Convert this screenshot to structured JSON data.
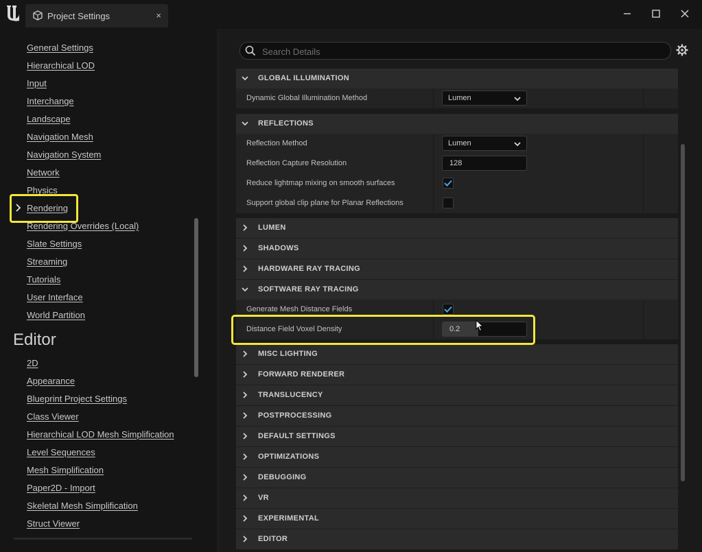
{
  "window": {
    "tab_title": "Project Settings",
    "tab_close": "×"
  },
  "sidebar": {
    "items": [
      {
        "label": "General Settings"
      },
      {
        "label": "Hierarchical LOD"
      },
      {
        "label": "Input"
      },
      {
        "label": "Interchange"
      },
      {
        "label": "Landscape"
      },
      {
        "label": "Navigation Mesh"
      },
      {
        "label": "Navigation System"
      },
      {
        "label": "Network"
      },
      {
        "label": "Physics"
      },
      {
        "label": "Rendering",
        "selected": true
      },
      {
        "label": "Rendering Overrides (Local)"
      },
      {
        "label": "Slate Settings"
      },
      {
        "label": "Streaming"
      },
      {
        "label": "Tutorials"
      },
      {
        "label": "User Interface"
      },
      {
        "label": "World Partition"
      }
    ],
    "editor_heading": "Editor",
    "editor_items": [
      {
        "label": "2D"
      },
      {
        "label": "Appearance"
      },
      {
        "label": "Blueprint Project Settings"
      },
      {
        "label": "Class Viewer"
      },
      {
        "label": "Hierarchical LOD Mesh Simplification"
      },
      {
        "label": "Level Sequences"
      },
      {
        "label": "Mesh Simplification"
      },
      {
        "label": "Paper2D - Import"
      },
      {
        "label": "Skeletal Mesh Simplification"
      },
      {
        "label": "Struct Viewer"
      }
    ]
  },
  "search": {
    "placeholder": "Search Details"
  },
  "details": {
    "global_illumination": {
      "label": "GLOBAL ILLUMINATION",
      "dynamic_gi_method": {
        "label": "Dynamic Global Illumination Method",
        "value": "Lumen"
      }
    },
    "reflections": {
      "label": "REFLECTIONS",
      "reflection_method": {
        "label": "Reflection Method",
        "value": "Lumen"
      },
      "capture_resolution": {
        "label": "Reflection Capture Resolution",
        "value": "128"
      },
      "reduce_lightmap_mixing": {
        "label": "Reduce lightmap mixing on smooth surfaces",
        "checked": true
      },
      "global_clip_plane": {
        "label": "Support global clip plane for Planar Reflections",
        "checked": false
      }
    },
    "lumen": {
      "label": "LUMEN"
    },
    "shadows": {
      "label": "SHADOWS"
    },
    "hardware_ray_tracing": {
      "label": "HARDWARE RAY TRACING"
    },
    "software_ray_tracing": {
      "label": "SOFTWARE RAY TRACING",
      "generate_mesh_distance_fields": {
        "label": "Generate Mesh Distance Fields",
        "checked": true
      },
      "distance_field_voxel_density": {
        "label": "Distance Field Voxel Density",
        "value": "0.2"
      }
    },
    "misc_lighting": {
      "label": "MISC LIGHTING"
    },
    "forward_renderer": {
      "label": "FORWARD RENDERER"
    },
    "translucency": {
      "label": "TRANSLUCENCY"
    },
    "postprocessing": {
      "label": "POSTPROCESSING"
    },
    "default_settings": {
      "label": "DEFAULT SETTINGS"
    },
    "optimizations": {
      "label": "OPTIMIZATIONS"
    },
    "debugging": {
      "label": "DEBUGGING"
    },
    "vr": {
      "label": "VR"
    },
    "experimental": {
      "label": "EXPERIMENTAL"
    },
    "editor": {
      "label": "EDITOR"
    }
  },
  "colors": {
    "highlight": "#f5e63a",
    "checkmark": "#4aa3e8",
    "background": "#151515"
  }
}
